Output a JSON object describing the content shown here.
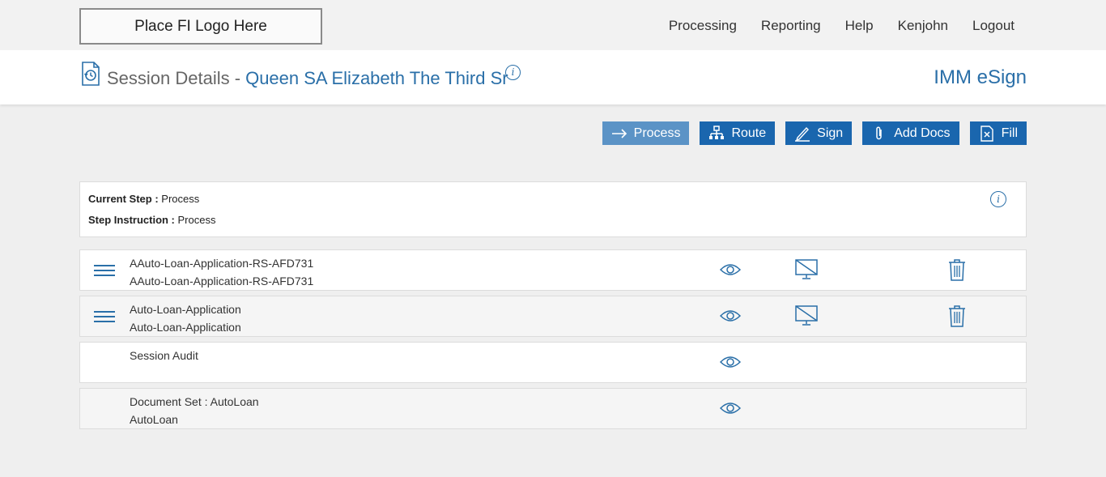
{
  "logo": {
    "text": "Place FI Logo Here"
  },
  "nav": {
    "items": [
      "Processing",
      "Reporting",
      "Help",
      "Kenjohn",
      "Logout"
    ]
  },
  "header": {
    "title_prefix": "Session Details -",
    "title_name": "Queen SA Elizabeth The Third Sr",
    "info_glyph": "i",
    "brand": "IMM eSign"
  },
  "actions": [
    {
      "label": "Process",
      "icon": "arrow-right-icon"
    },
    {
      "label": "Route",
      "icon": "network-icon"
    },
    {
      "label": "Sign",
      "icon": "pen-icon"
    },
    {
      "label": "Add Docs",
      "icon": "paperclip-icon"
    },
    {
      "label": "Fill",
      "icon": "form-fill-icon"
    }
  ],
  "step": {
    "current_label": "Current Step :",
    "current_value": "Process",
    "instruction_label": "Step Instruction :",
    "instruction_value": "Process",
    "info_glyph": "i"
  },
  "documents": [
    {
      "line1": "AAuto-Loan-Application-RS-AFD731",
      "line2": "AAuto-Loan-Application-RS-AFD731"
    },
    {
      "line1": "Auto-Loan-Application",
      "line2": "Auto-Loan-Application"
    },
    {
      "line1": "Session Audit",
      "line2": ""
    },
    {
      "line1": "Document Set : AutoLoan",
      "line2": "AutoLoan"
    }
  ],
  "colors": {
    "accent": "#2a6fa8",
    "button": "#1a66ae",
    "button_active": "#5b93c6"
  }
}
